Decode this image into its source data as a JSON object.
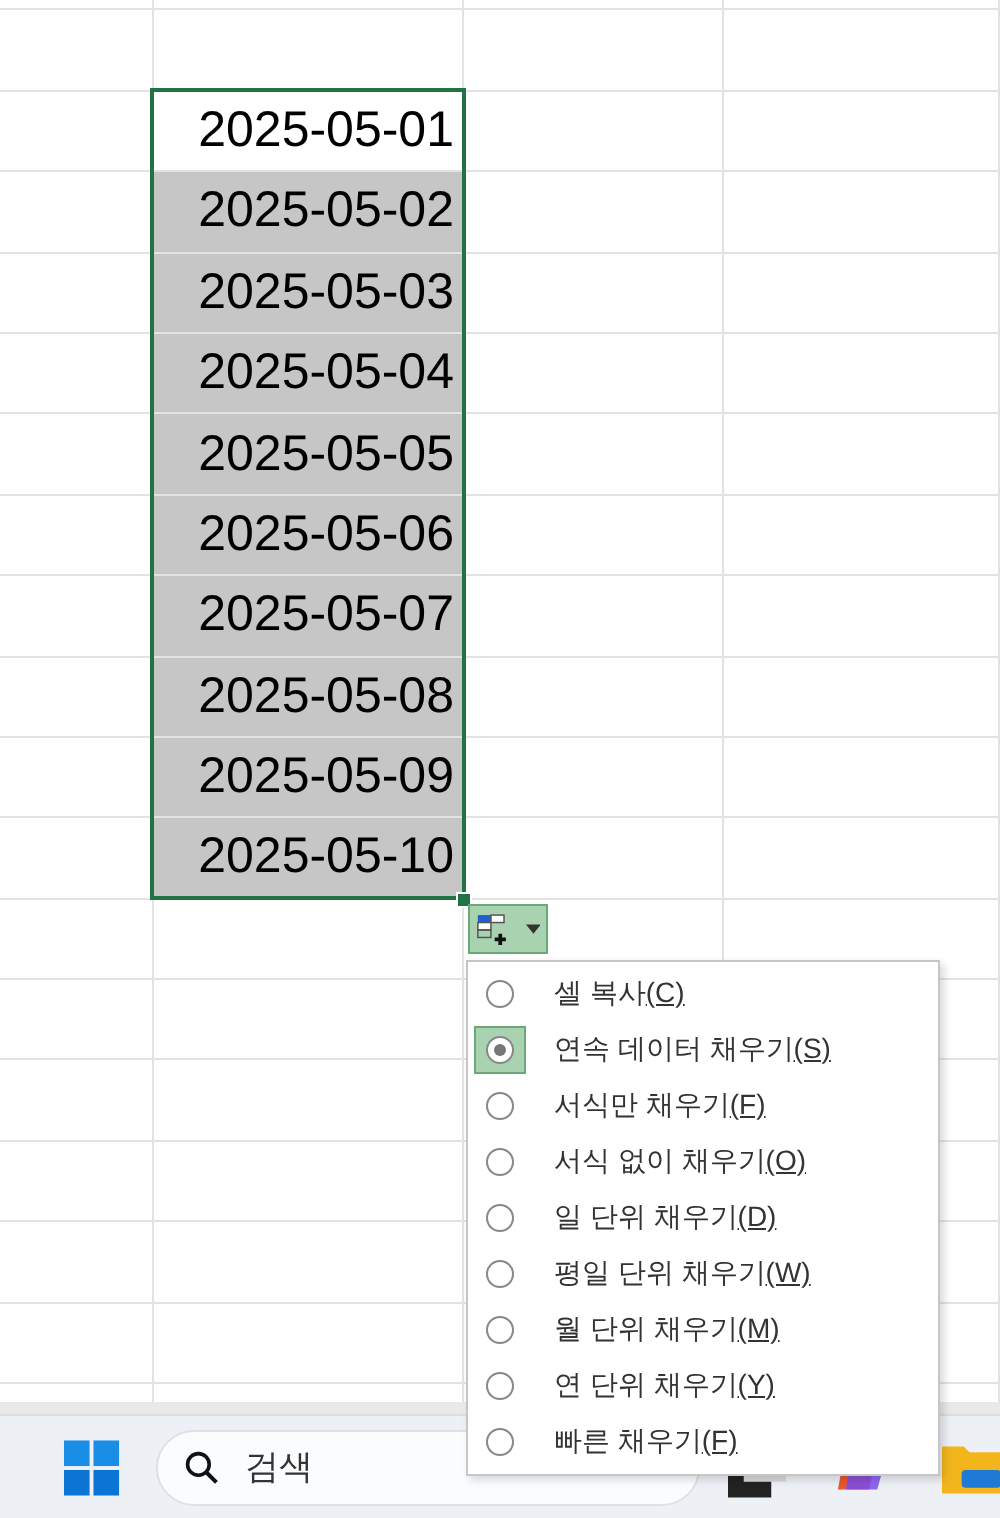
{
  "cells": [
    {
      "text": "2025-05-01",
      "highlighted": false
    },
    {
      "text": "2025-05-02",
      "highlighted": true
    },
    {
      "text": "2025-05-03",
      "highlighted": true
    },
    {
      "text": "2025-05-04",
      "highlighted": true
    },
    {
      "text": "2025-05-05",
      "highlighted": true
    },
    {
      "text": "2025-05-06",
      "highlighted": true
    },
    {
      "text": "2025-05-07",
      "highlighted": true
    },
    {
      "text": "2025-05-08",
      "highlighted": true
    },
    {
      "text": "2025-05-09",
      "highlighted": true
    },
    {
      "text": "2025-05-10",
      "highlighted": true
    }
  ],
  "autofill_menu": {
    "options": [
      {
        "label": "셀 복사",
        "accel": "(C)",
        "selected": false
      },
      {
        "label": "연속 데이터 채우기",
        "accel": "(S)",
        "selected": true
      },
      {
        "label": "서식만 채우기",
        "accel": "(F)",
        "selected": false
      },
      {
        "label": "서식 없이 채우기",
        "accel": "(O)",
        "selected": false
      },
      {
        "label": "일 단위 채우기",
        "accel": "(D)",
        "selected": false
      },
      {
        "label": "평일 단위 채우기",
        "accel": "(W)",
        "selected": false
      },
      {
        "label": "월 단위 채우기",
        "accel": "(M)",
        "selected": false
      },
      {
        "label": "연 단위 채우기",
        "accel": "(Y)",
        "selected": false
      },
      {
        "label": "빠른 채우기",
        "accel": "(F)",
        "selected": false
      }
    ]
  },
  "taskbar": {
    "search": {
      "placeholder": "검색"
    }
  }
}
